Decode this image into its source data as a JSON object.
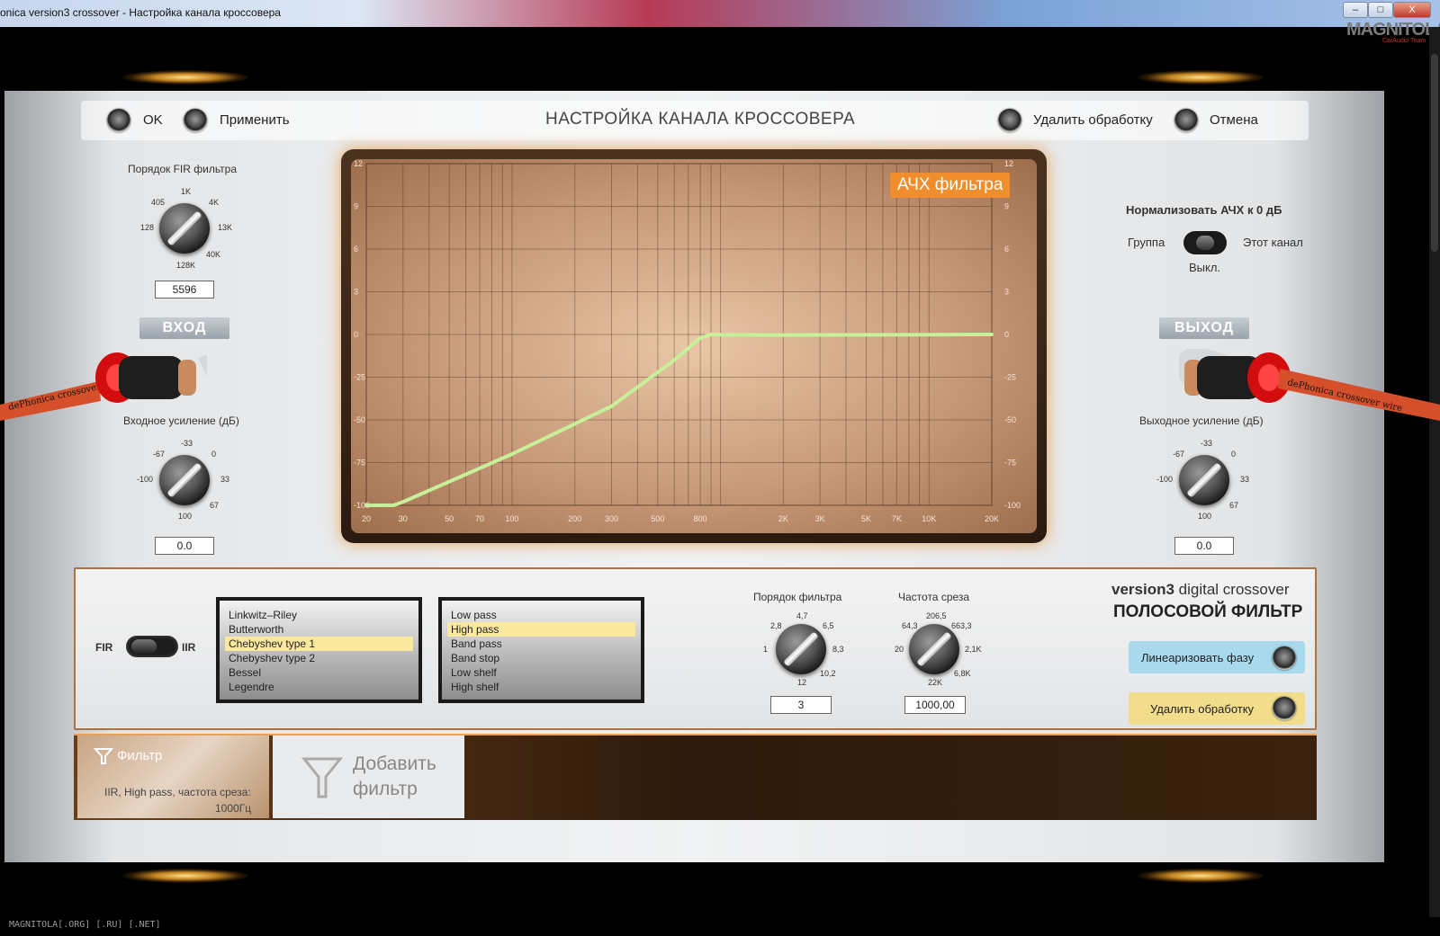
{
  "window": {
    "title": "onica version3 crossover - Настройка канала кроссовера",
    "minimize": "–",
    "maximize": "□",
    "close": "X"
  },
  "watermark": {
    "logo": "MAGNITOLA",
    "sub": "CarAudio Team",
    "footer": "MAGNITOLA[.ORG] [.RU] [.NET]"
  },
  "header": {
    "ok_label": "OK",
    "apply_label": "Применить",
    "title": "НАСТРОЙКА КАНАЛА КРОССОВЕРА",
    "remove_label": "Удалить обработку",
    "cancel_label": "Отмена"
  },
  "fir": {
    "label": "Порядок FIR фильтра",
    "scale": [
      "1K",
      "4K",
      "13K",
      "40K",
      "128K",
      "128",
      "405"
    ],
    "value": "5596"
  },
  "input": {
    "tag": "ВХОД",
    "gain_label": "Входное усиление (дБ)",
    "scale": [
      "-33",
      "0",
      "33",
      "67",
      "100",
      "-100",
      "-67"
    ],
    "value": "0.0",
    "cable_text": "dePhonica crossover wire"
  },
  "output": {
    "tag": "ВЫХОД",
    "gain_label": "Выходное усиление (дБ)",
    "scale": [
      "-33",
      "0",
      "33",
      "67",
      "100",
      "-100",
      "-67"
    ],
    "value": "0.0",
    "cable_text": "dePhonica crossover wire"
  },
  "normalize": {
    "label": "Нормализовать АЧХ к 0 дБ",
    "left": "Группа",
    "right": "Этот канал",
    "state": "Выкл."
  },
  "graph": {
    "badge": "АЧХ фильтра"
  },
  "chart_data": {
    "type": "line",
    "title": "АЧХ фильтра",
    "x_scale": "log",
    "grid": true,
    "x_ticks": [
      "20",
      "30",
      "50",
      "70",
      "100",
      "200",
      "300",
      "500",
      "800",
      "2K",
      "3K",
      "5K",
      "7K",
      "10K",
      "20K"
    ],
    "y_ticks": [
      "12",
      "9",
      "6",
      "3",
      "0",
      "-25",
      "-50",
      "-75",
      "-100"
    ],
    "y_ticks_right": [
      "12",
      "9",
      "6",
      "3",
      "0",
      "-25",
      "-50",
      "-75",
      "-100"
    ],
    "series": [
      {
        "color": "#c7f09a",
        "x": [
          20,
          27,
          30,
          100,
          300,
          600,
          800,
          900,
          1000,
          2000,
          5000,
          10000,
          20000
        ],
        "y": [
          -100,
          -100,
          -98,
          -70,
          -42,
          -15,
          -2,
          0,
          -0.2,
          -0.3,
          -0.2,
          -0.1,
          0
        ]
      }
    ]
  },
  "filter": {
    "mode_left": "FIR",
    "mode_right": "IIR",
    "types": [
      "Linkwitz–Riley",
      "Butterworth",
      "Chebyshev type 1",
      "Chebyshev type 2",
      "Bessel",
      "Legendre"
    ],
    "type_selected": 2,
    "kinds": [
      "Low pass",
      "High pass",
      "Band pass",
      "Band stop",
      "Low shelf",
      "High shelf"
    ],
    "kind_selected": 1,
    "order_label": "Порядок фильтра",
    "order_scale": [
      "2,8",
      "4,7",
      "6,5",
      "1",
      "8,3",
      "10,2",
      "12"
    ],
    "order_value": "3",
    "freq_label": "Частота среза",
    "freq_scale": [
      "64,3",
      "206,5",
      "663,3",
      "20",
      "2,1K",
      "6,8K",
      "22K"
    ],
    "freq_value": "1000,00"
  },
  "brand": {
    "line1_bold": "version3",
    "line1_rest": " digital crossover",
    "line2": "ПОЛОСОВОЙ ФИЛЬТР"
  },
  "actions": {
    "linearize": "Линеаризовать фазу",
    "remove": "Удалить обработку"
  },
  "bottom": {
    "card_title": "Фильтр",
    "card_desc1": "IIR, High pass, частота среза:",
    "card_desc2": "1000Гц",
    "add_line1": "Добавить",
    "add_line2": "фильтр"
  },
  "colors": {
    "accent_orange": "#f08d2c",
    "curve": "#c7f09a",
    "graph_bg": "#c49574",
    "link_btn": "#a8d9ec",
    "delete_btn": "#f2dd8c"
  }
}
